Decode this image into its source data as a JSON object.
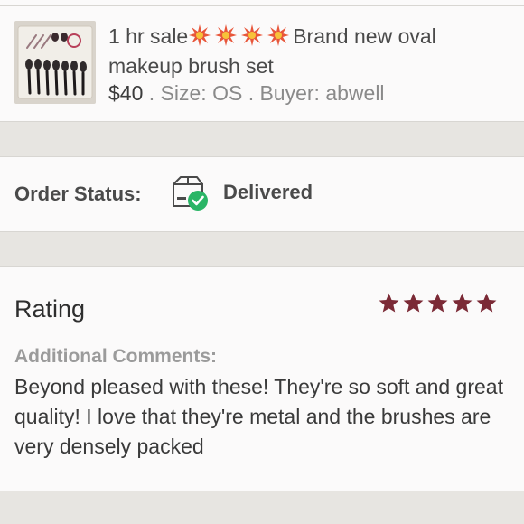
{
  "listing": {
    "title_prefix": "1 hr sale",
    "title_suffix": "Brand new oval makeup brush set",
    "title_icons": [
      "burst-icon",
      "burst-icon",
      "burst-icon",
      "burst-icon"
    ],
    "price": "$40",
    "size_text": " . Size: OS . Buyer: abwell"
  },
  "order_status": {
    "label": "Order Status:",
    "icon": "package-check-icon",
    "value": "Delivered"
  },
  "rating": {
    "heading": "Rating",
    "stars": 5,
    "star_color": "#7b2a36",
    "comments_label": "Additional Comments:",
    "comments": "Beyond pleased with these! They're so soft and great quality! I love that they're metal and the brushes are very densely packed"
  },
  "colors": {
    "background": "#e7e5e1",
    "card": "#fbfafa",
    "success": "#2ab566",
    "burst": "#e8563a"
  }
}
